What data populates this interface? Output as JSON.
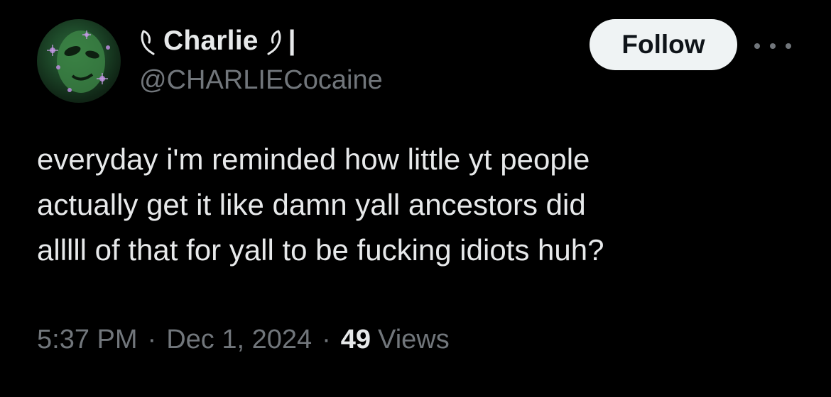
{
  "author": {
    "display_name": "Charlie",
    "name_suffix": "|",
    "handle": "@CHARLIECocaine",
    "avatar_icon": "avatar-image"
  },
  "actions": {
    "follow_label": "Follow",
    "more_icon": "more-options-icon"
  },
  "tweet": {
    "lines": [
      "everyday i'm reminded how little yt people",
      "actually get it like damn yall ancestors did",
      "alllll of that for yall to be fucking idiots huh?"
    ]
  },
  "meta": {
    "time": "5:37 PM",
    "separator": "·",
    "date": "Dec 1, 2024",
    "views_count": "49",
    "views_label": "Views"
  },
  "colors": {
    "background": "#000000",
    "primary_text": "#e7e9ea",
    "secondary_text": "#71767b",
    "follow_bg": "#eff3f4",
    "follow_text": "#0f1419"
  }
}
